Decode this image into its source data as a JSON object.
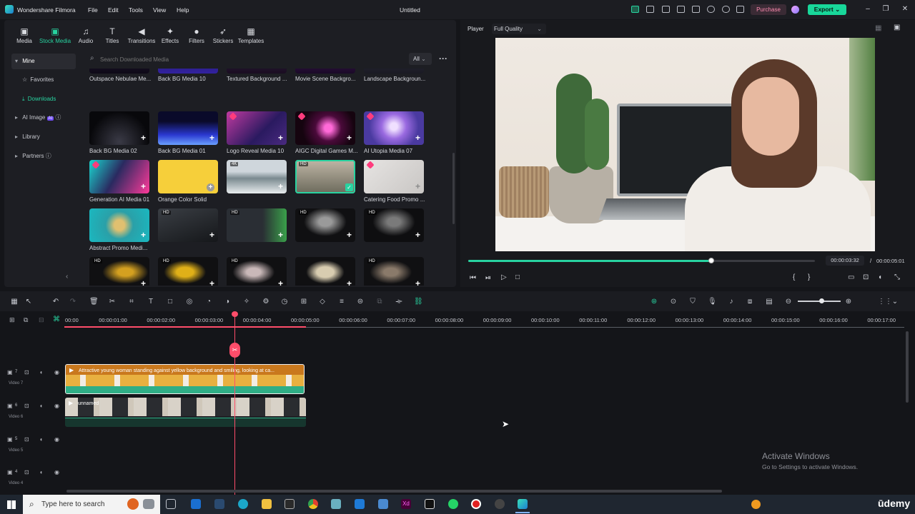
{
  "app": {
    "title": "Wondershare Filmora",
    "document": "Untitled",
    "purchase": "Purchase",
    "export": "Export"
  },
  "menu": [
    "File",
    "Edit",
    "Tools",
    "View",
    "Help"
  ],
  "toolbar_tabs": [
    {
      "label": "Media",
      "icon": "media-icon"
    },
    {
      "label": "Stock Media",
      "icon": "stock-media-icon"
    },
    {
      "label": "Audio",
      "icon": "audio-icon"
    },
    {
      "label": "Titles",
      "icon": "titles-icon"
    },
    {
      "label": "Transitions",
      "icon": "transitions-icon"
    },
    {
      "label": "Effects",
      "icon": "effects-icon"
    },
    {
      "label": "Filters",
      "icon": "filters-icon"
    },
    {
      "label": "Stickers",
      "icon": "stickers-icon"
    },
    {
      "label": "Templates",
      "icon": "templates-icon"
    }
  ],
  "sidebar": {
    "items": [
      {
        "label": "Mine"
      },
      {
        "label": "Favorites"
      },
      {
        "label": "Downloads"
      },
      {
        "label": "AI Image"
      },
      {
        "label": "Library"
      },
      {
        "label": "Partners"
      }
    ]
  },
  "search": {
    "placeholder": "Search Downloaded Media",
    "filter": "All"
  },
  "media_labels": {
    "row0": [
      "Outspace Nebulae Me...",
      "Back BG Media 10",
      "Textured Background ...",
      "Movie Scene Backgro...",
      "Landscape Backgroun..."
    ],
    "row1": [
      "Back BG Media 02",
      "Back BG Media 01",
      "Logo Reveal Media 10",
      "AIGC Digital Games M...",
      "AI Utopia Media 07"
    ],
    "row2": [
      "Generation AI Media 01",
      "Orange Color Solid",
      "",
      "",
      "Catering Food Promo ..."
    ],
    "row3": [
      "Abstract Promo Medi...",
      "",
      "",
      "",
      ""
    ]
  },
  "badges": {
    "hd": "HD",
    "k4": "4K",
    "ai": "AI"
  },
  "player": {
    "label": "Player",
    "quality": "Full Quality",
    "current_time": "00:00:03:32",
    "separator": "/",
    "total_time": "00:00:05:01",
    "progress": 0.7
  },
  "timeline": {
    "ruler": [
      "00:00",
      "00:00:01:00",
      "00:00:02:00",
      "00:00:03:00",
      "00:00:04:00",
      "00:00:05:00",
      "00:00:06:00",
      "00:00:07:00",
      "00:00:08:00",
      "00:00:09:00",
      "00:00:10:00",
      "00:00:11:00",
      "00:00:12:00",
      "00:00:13:00",
      "00:00:14:00",
      "00:00:15:00",
      "00:00:16:00",
      "00:00:17:00"
    ],
    "tracks": [
      {
        "name": "Video 7",
        "num": "7"
      },
      {
        "name": "Video 6",
        "num": "6"
      },
      {
        "name": "Video 5",
        "num": "5"
      },
      {
        "name": "Video 4",
        "num": "4"
      }
    ],
    "clip_video": "Attractive young woman standing against yellow background and smiling, looking at ca...",
    "clip_other": "unnamed"
  },
  "watermark": {
    "line1": "Activate Windows",
    "line2": "Go to Settings to activate Windows."
  },
  "taskbar": {
    "search": "Type here to search",
    "brand": "ūdemy"
  },
  "colors": {
    "accent": "#28d3a0",
    "export": "#18d79a",
    "playhead": "#ff4d6a",
    "clip_orange": "#c9781d",
    "clip_green": "#2fae86"
  }
}
